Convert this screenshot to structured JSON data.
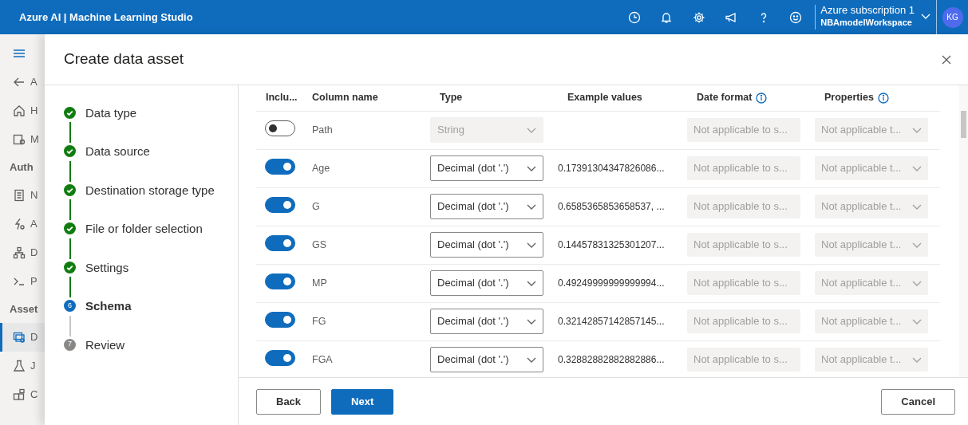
{
  "topbar": {
    "title": "Azure AI | Machine Learning Studio",
    "subscription": "Azure subscription 1",
    "workspace": "NBAmodelWorkspace",
    "avatar": "KG",
    "icons": [
      {
        "kind": "clock"
      },
      {
        "kind": "bell"
      },
      {
        "kind": "gear"
      },
      {
        "kind": "megaphone"
      },
      {
        "kind": "help"
      },
      {
        "kind": "smiley"
      }
    ]
  },
  "background_nav": {
    "items": [
      {
        "kind": "back",
        "text": "A",
        "selected": false
      },
      {
        "kind": "home",
        "text": "H",
        "selected": false
      },
      {
        "kind": "catalog",
        "text": "M",
        "selected": false
      },
      {
        "kind": "heading",
        "text": "Auth"
      },
      {
        "kind": "notebook",
        "text": "N",
        "selected": false
      },
      {
        "kind": "automl",
        "text": "A",
        "selected": false
      },
      {
        "kind": "designer",
        "text": "D",
        "selected": false
      },
      {
        "kind": "prompt",
        "text": "P",
        "selected": false
      },
      {
        "kind": "heading",
        "text": "Asset"
      },
      {
        "kind": "data",
        "text": "D",
        "selected": true
      },
      {
        "kind": "jobs",
        "text": "J",
        "selected": false
      },
      {
        "kind": "components",
        "text": "C",
        "selected": false
      }
    ]
  },
  "panel": {
    "title": "Create data asset",
    "steps": [
      {
        "label": "Data type",
        "completed": true,
        "selected": false
      },
      {
        "label": "Data source",
        "completed": true,
        "selected": false
      },
      {
        "label": "Destination storage type",
        "completed": true,
        "selected": false
      },
      {
        "label": "File or folder selection",
        "completed": true,
        "selected": false
      },
      {
        "label": "Settings",
        "completed": true,
        "selected": false
      },
      {
        "label": "Schema",
        "completed": false,
        "selected": true,
        "number": "6"
      },
      {
        "label": "Review",
        "completed": false,
        "selected": false,
        "number": "7"
      }
    ],
    "table": {
      "columns": [
        {
          "label": "Inclu...",
          "kind": "plain"
        },
        {
          "label": "Column name",
          "kind": "plain"
        },
        {
          "label": "Type",
          "kind": "plain"
        },
        {
          "label": "Example values",
          "kind": "plain"
        },
        {
          "label": "Date format",
          "kind": "info"
        },
        {
          "label": "Properties",
          "kind": "info"
        }
      ],
      "rows": [
        {
          "include": false,
          "name": "Path",
          "type": "String",
          "type_disabled": true,
          "date_format": "Not applicable to s...",
          "properties": "Not applicable t..."
        },
        {
          "include": true,
          "name": "Age",
          "type": "Decimal (dot '.')",
          "type_disabled": false,
          "example": "0.17391304347826086...",
          "date_format": "Not applicable to s...",
          "properties": "Not applicable t..."
        },
        {
          "include": true,
          "name": "G",
          "type": "Decimal (dot '.')",
          "type_disabled": false,
          "example": "0.6585365853658537, ...",
          "date_format": "Not applicable to s...",
          "properties": "Not applicable t..."
        },
        {
          "include": true,
          "name": "GS",
          "type": "Decimal (dot '.')",
          "type_disabled": false,
          "example": "0.14457831325301207...",
          "date_format": "Not applicable to s...",
          "properties": "Not applicable t..."
        },
        {
          "include": true,
          "name": "MP",
          "type": "Decimal (dot '.')",
          "type_disabled": false,
          "example": "0.49249999999999994...",
          "date_format": "Not applicable to s...",
          "properties": "Not applicable t..."
        },
        {
          "include": true,
          "name": "FG",
          "type": "Decimal (dot '.')",
          "type_disabled": false,
          "example": "0.32142857142857145...",
          "date_format": "Not applicable to s...",
          "properties": "Not applicable t..."
        },
        {
          "include": true,
          "name": "FGA",
          "type": "Decimal (dot '.')",
          "type_disabled": false,
          "example": "0.32882882882882886...",
          "date_format": "Not applicable to s...",
          "properties": "Not applicable t..."
        }
      ]
    },
    "footer": {
      "back": "Back",
      "next": "Next",
      "cancel": "Cancel"
    }
  }
}
